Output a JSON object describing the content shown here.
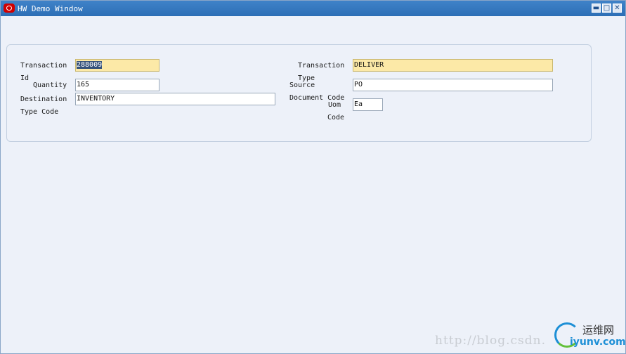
{
  "window": {
    "title": "HW Demo Window",
    "controls": {
      "minimize": "▬",
      "maximize": "□",
      "close": "✕"
    }
  },
  "form": {
    "transaction_id": {
      "label_line1": "Transaction",
      "label_line2": "Id",
      "value": "288009"
    },
    "quantity": {
      "label": "Quantity",
      "value": "165"
    },
    "destination_type_code": {
      "label_line1": "Destination",
      "label_line2": "Type Code",
      "value": "INVENTORY"
    },
    "transaction_type": {
      "label_line1": "Transaction",
      "label_line2": "Type",
      "value": "DELIVER"
    },
    "source_document_code": {
      "label_line1": "Source",
      "label_line2": "Document Code",
      "value": "PO"
    },
    "uom_code": {
      "label_line1": "Uom",
      "label_line2": "Code",
      "value": "Ea"
    }
  },
  "watermark": {
    "url": "http://blog.csdn.",
    "brand_cn": "运维网",
    "brand_en": "iyunv.com"
  },
  "colors": {
    "titlebar": "#2d6fb6",
    "readonly_field": "#fce9a7",
    "background": "#edf1f9",
    "selection": "#34517a"
  }
}
